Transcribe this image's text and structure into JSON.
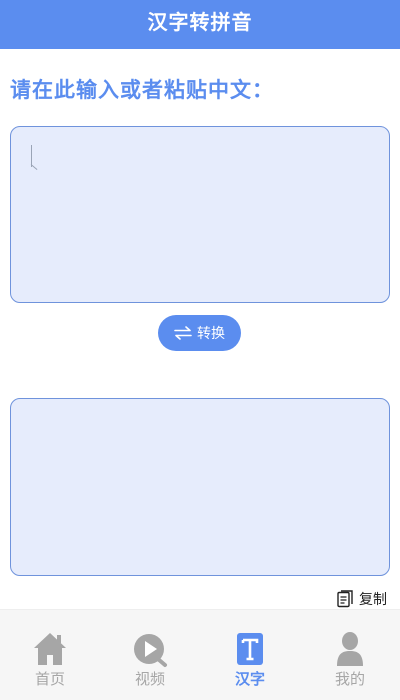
{
  "header": {
    "title": "汉字转拼音"
  },
  "main": {
    "prompt": "请在此输入或者粘贴中文：",
    "input": {
      "value": ""
    },
    "convert_button": {
      "label": "转换",
      "icon": "swap-arrows-icon"
    },
    "output": {
      "value": ""
    },
    "copy_button": {
      "label": "复制",
      "icon": "copy-icon"
    }
  },
  "tabbar": {
    "items": [
      {
        "label": "首页",
        "icon": "home-icon",
        "active": false
      },
      {
        "label": "视频",
        "icon": "video-play-icon",
        "active": false
      },
      {
        "label": "汉字",
        "icon": "text-t-icon",
        "active": true
      },
      {
        "label": "我的",
        "icon": "user-icon",
        "active": false
      }
    ]
  },
  "colors": {
    "accent": "#5b8def",
    "field_bg": "#e6ecfc",
    "field_border": "#6f93dc",
    "inactive": "#a6a6a6"
  }
}
